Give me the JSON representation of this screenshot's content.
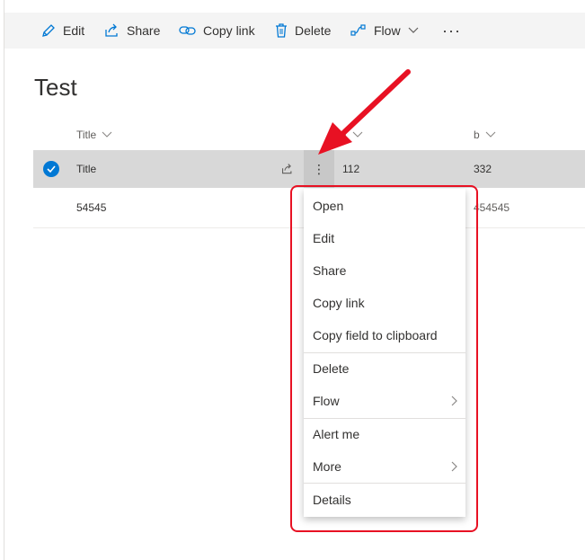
{
  "toolbar": {
    "edit": "Edit",
    "share": "Share",
    "copy_link": "Copy link",
    "delete": "Delete",
    "flow": "Flow",
    "more": "···"
  },
  "page": {
    "title": "Test"
  },
  "columns": {
    "title": "Title",
    "a": "a",
    "b": "b"
  },
  "rows": [
    {
      "title": "Title",
      "a": "112",
      "b": "332",
      "selected": true
    },
    {
      "title": "54545",
      "a": "",
      "b": "454545",
      "selected": false
    }
  ],
  "row_menu_glyph": "⋮",
  "context_menu": {
    "items": [
      "Open",
      "Edit",
      "Share",
      "Copy link",
      "Copy field to clipboard",
      "Delete",
      "Flow",
      "Alert me",
      "More",
      "Details"
    ]
  },
  "colors": {
    "accent": "#0078d4",
    "annotation": "#e81123",
    "selected_row": "#d8d8d8",
    "commandbar": "#f4f4f4"
  },
  "icons": [
    "edit-icon",
    "share-icon",
    "link-icon",
    "delete-icon",
    "flow-icon",
    "chevron-down-icon",
    "checkmark-icon",
    "chevron-right-icon"
  ]
}
